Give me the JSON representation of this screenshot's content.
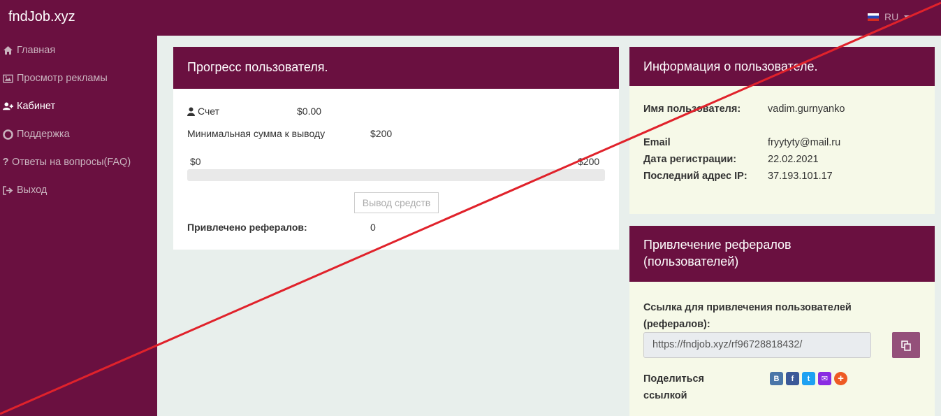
{
  "header": {
    "brand": "fndJob.xyz",
    "language": "RU"
  },
  "sidebar": {
    "items": [
      {
        "label": "Главная",
        "icon": "home-icon"
      },
      {
        "label": "Просмотр рекламы",
        "icon": "image-icon"
      },
      {
        "label": "Кабинет",
        "icon": "user-plus-icon",
        "active": true
      },
      {
        "label": "Поддержка",
        "icon": "life-ring-icon"
      },
      {
        "label": "Ответы на вопросы(FAQ)",
        "icon": "question-icon"
      },
      {
        "label": "Выход",
        "icon": "sign-out-icon"
      }
    ]
  },
  "progress": {
    "title": "Прогресс пользователя.",
    "account_label": "Счет",
    "account_value": "$0.00",
    "min_label": "Минимальная сумма к выводу",
    "min_value": "$200",
    "bar_min": "$0",
    "bar_max": "$200",
    "bar_fraction": 0,
    "withdraw_button": "Вывод средств",
    "referrals_label": "Привлечено рефералов:",
    "referrals_value": "0"
  },
  "info": {
    "title": "Информация о пользователе.",
    "username_label": "Имя пользователя:",
    "username_value": "vadim.gurnyanko",
    "email_label": "Email",
    "email_value": "fryytyty@mail.ru",
    "reg_label": "Дата регистрации:",
    "reg_value": "22.02.2021",
    "ip_label": "Последний адрес IP:",
    "ip_value": "37.193.101.17"
  },
  "referral": {
    "title": "Привлечение рефералов (пользователей)",
    "link_label": "Ссылка для привлечения пользователей (рефералов):",
    "link_value": "https://fndjob.xyz/rf96728818432/",
    "share_label": "Поделиться ссылкой",
    "share_buttons": [
      {
        "name": "vk",
        "glyph": "B",
        "color": "#4a76a8"
      },
      {
        "name": "facebook",
        "glyph": "f",
        "color": "#3b5998"
      },
      {
        "name": "twitter",
        "glyph": "t",
        "color": "#1da1f2"
      },
      {
        "name": "mail",
        "glyph": "✉",
        "color": "#8a2be2"
      },
      {
        "name": "more",
        "glyph": "+",
        "color": "#ee5a24"
      }
    ]
  },
  "colors": {
    "brand": "#6a1040",
    "panel_bg": "#f6f9e8",
    "copy_button": "#94507a",
    "overlay_line": "#e0222b"
  }
}
